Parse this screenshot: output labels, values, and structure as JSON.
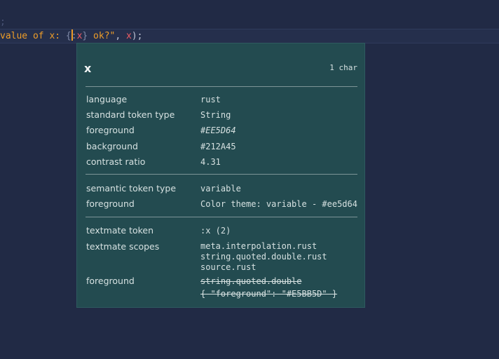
{
  "editor": {
    "line_above": ";",
    "code": {
      "prefix": "value of x: ",
      "brace_open": "{",
      "colon": ":",
      "var": "x",
      "brace_close": "}",
      "suffix": " ok?\"",
      "comma": ", ",
      "arg": "x",
      "close": ");"
    }
  },
  "hover": {
    "token_name": "x",
    "length": "1 char",
    "general": [
      {
        "label": "language",
        "value": "rust"
      },
      {
        "label": "standard token type",
        "value": "String"
      },
      {
        "label": "foreground",
        "value": "#EE5D64"
      },
      {
        "label": "background",
        "value": "#212A45"
      },
      {
        "label": "contrast ratio",
        "value": "4.31"
      }
    ],
    "semantic": [
      {
        "label": "semantic token type",
        "value": "variable"
      },
      {
        "label": "foreground",
        "value": "Color theme: variable - #ee5d64"
      }
    ],
    "textmate": {
      "token_label": "textmate token",
      "token_value": ":x (2)",
      "scopes_label": "textmate scopes",
      "scopes": [
        "meta.interpolation.rust",
        "string.quoted.double.rust",
        "source.rust"
      ],
      "foreground_label": "foreground",
      "foreground_lines": [
        "string.quoted.double",
        "{ \"foreground\": \"#E5BB5D\" }"
      ]
    }
  },
  "colors": {
    "editor_background": "#212A45",
    "hover_background": "#234B50",
    "token_foreground": "#EE5D64",
    "string_foreground": "#EE9D28"
  }
}
